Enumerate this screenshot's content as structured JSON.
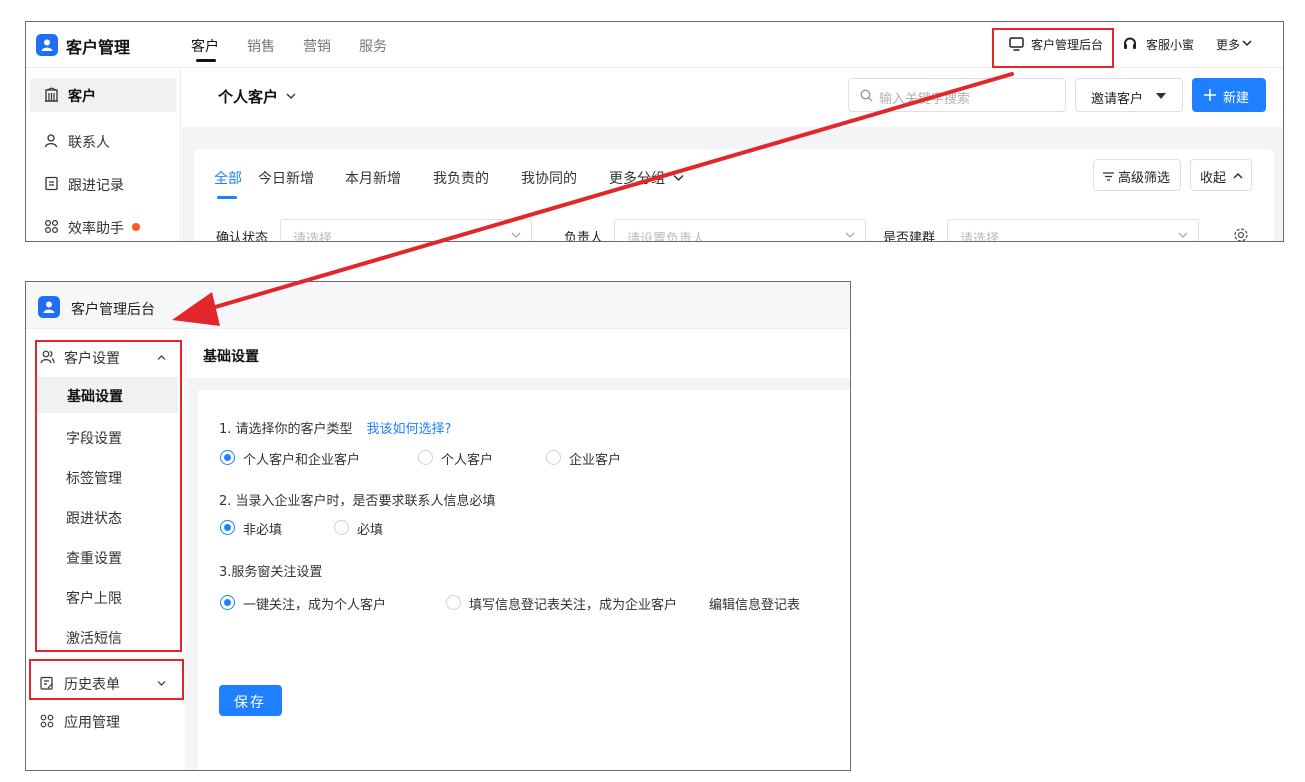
{
  "colors": {
    "accent": "#1e80ff",
    "highlight_red": "#e3262b",
    "dot_orange": "#ff5a1f"
  },
  "top_panel": {
    "app_title": "客户管理",
    "nav_tabs": [
      "客户",
      "销售",
      "营销",
      "服务"
    ],
    "header_right": {
      "admin": "客户管理后台",
      "service": "客服小蜜",
      "more": "更多"
    },
    "sidebar": [
      {
        "label": "客户",
        "icon": "building-icon"
      },
      {
        "label": "联系人",
        "icon": "person-icon"
      },
      {
        "label": "跟进记录",
        "icon": "note-icon"
      },
      {
        "label": "效率助手",
        "icon": "apps-icon"
      }
    ],
    "page_title": "个人客户",
    "search_placeholder": "输入关键字搜索",
    "invite_btn": "邀请客户",
    "new_btn": "新建",
    "filter_tabs": [
      "全部",
      "今日新增",
      "本月新增",
      "我负责的",
      "我协同的",
      "更多分组"
    ],
    "advanced_filter": "高级筛选",
    "collapse": "收起",
    "filters": [
      {
        "label": "确认状态",
        "placeholder": "请选择"
      },
      {
        "label": "负责人",
        "placeholder": "请设置负责人"
      },
      {
        "label": "是否建群",
        "placeholder": "请选择"
      }
    ]
  },
  "bottom_panel": {
    "app_title": "客户管理后台",
    "sidebar": {
      "group1": "客户设置",
      "items": [
        "基础设置",
        "字段设置",
        "标签管理",
        "跟进状态",
        "查重设置",
        "客户上限",
        "激活短信"
      ],
      "group2": "历史表单",
      "group3": "应用管理"
    },
    "page_title": "基础设置",
    "q1": {
      "text": "1. 请选择你的客户类型",
      "link": "我该如何选择?",
      "options": [
        "个人客户和企业客户",
        "个人客户",
        "企业客户"
      ]
    },
    "q2": {
      "text": "2. 当录入企业客户时，是否要求联系人信息必填",
      "options": [
        "非必填",
        "必填"
      ]
    },
    "q3": {
      "text": "3.服务窗关注设置",
      "options": [
        "一键关注，成为个人客户",
        "填写信息登记表关注，成为企业客户"
      ],
      "link": "编辑信息登记表"
    },
    "save_btn": "保存"
  }
}
